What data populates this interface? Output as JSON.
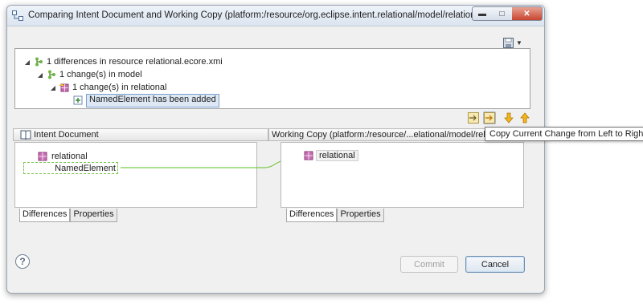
{
  "window": {
    "title": "Comparing Intent Document and Working Copy (platform:/resource/org.eclipse.intent.relational/model/relational.ecore)",
    "minimize_icon": "minimize-icon",
    "maximize_icon": "maximize-icon",
    "close_icon": "close-icon"
  },
  "tree": {
    "rows": [
      {
        "label": "1 differences in resource relational.ecore.xmi",
        "icon": "resource-diff-icon"
      },
      {
        "label": "1 change(s) in model",
        "icon": "model-diff-icon"
      },
      {
        "label": "1 change(s) in relational",
        "icon": "package-diff-icon"
      },
      {
        "label": "NamedElement has been added",
        "icon": "added-element-icon"
      }
    ]
  },
  "toolbar": {
    "save_icon": "save-icon",
    "copy_all_icon": "copy-all-left-to-right-icon",
    "copy_current_icon": "copy-current-left-to-right-icon",
    "next_icon": "next-change-arrow-down-icon",
    "prev_icon": "previous-change-arrow-up-icon",
    "tooltip": "Copy Current Change from Left to Right"
  },
  "left_pane": {
    "header": "Intent Document",
    "items": [
      "relational",
      "NamedElement"
    ],
    "tabs": [
      "Differences",
      "Properties"
    ]
  },
  "right_pane": {
    "header": "Working Copy (platform:/resource/...elational/model/relational.ecore)",
    "items": [
      "relational"
    ],
    "tabs": [
      "Differences",
      "Properties"
    ]
  },
  "buttons": {
    "help": "?",
    "commit": "Commit",
    "cancel": "Cancel"
  },
  "colors": {
    "accent_green": "#7ac94c",
    "selection": "#dde8f4"
  }
}
